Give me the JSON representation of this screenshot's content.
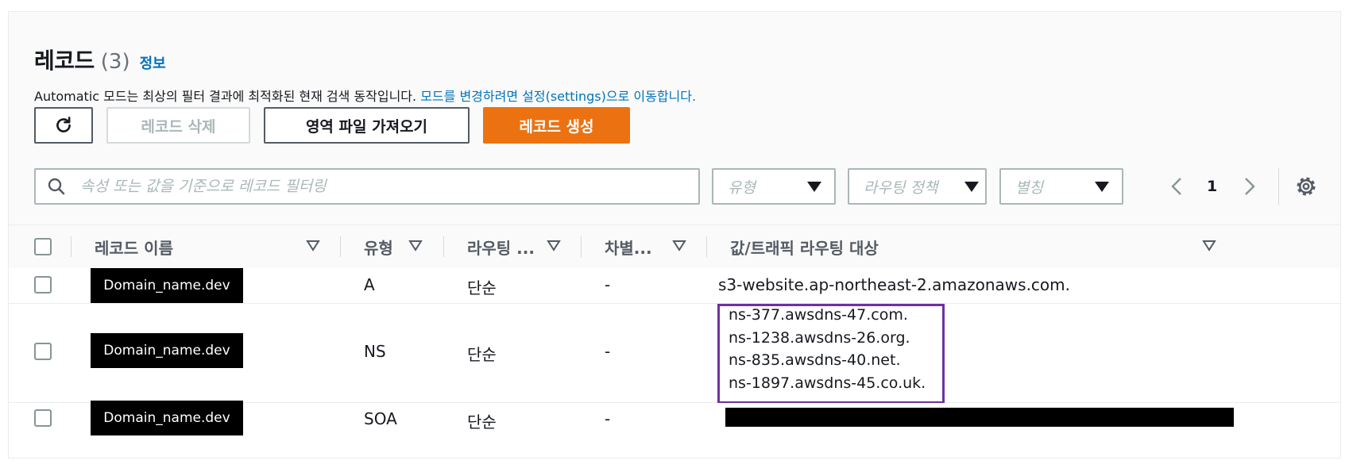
{
  "header": {
    "title": "레코드",
    "count": "(3)",
    "info_link": "정보",
    "description_prefix": "Automatic 모드는 최상의 필터 결과에 최적화된 현재 검색 동작입니다.",
    "description_link": "모드를 변경하려면 설정(settings)으로 이동합니다."
  },
  "actions": {
    "refresh_icon": "refresh-icon",
    "delete_label": "레코드 삭제",
    "import_label": "영역 파일 가져오기",
    "create_label": "레코드 생성",
    "create_color": "#ec7211"
  },
  "filters": {
    "search_placeholder": "속성 또는 값을 기준으로 레코드 필터링",
    "type_placeholder": "유형",
    "routing_placeholder": "라우팅 정책",
    "alias_placeholder": "별칭"
  },
  "pagination": {
    "current_page": "1"
  },
  "table": {
    "columns": [
      "레코드 이름",
      "유형",
      "라우팅 ...",
      "차별...",
      "값/트래픽 라우팅 대상"
    ],
    "rows": [
      {
        "name": "Domain_name.dev",
        "type": "A",
        "routing": "단순",
        "diff": "-",
        "values": [
          "s3-website.ap-northeast-2.amazonaws.com."
        ]
      },
      {
        "name": "Domain_name.dev",
        "type": "NS",
        "routing": "단순",
        "diff": "-",
        "values": [
          "ns-377.awsdns-47.com.",
          "ns-1238.awsdns-26.org.",
          "ns-835.awsdns-40.net.",
          "ns-1897.awsdns-45.co.uk."
        ]
      },
      {
        "name": "Domain_name.dev",
        "type": "SOA",
        "routing": "단순",
        "diff": "-",
        "values": []
      }
    ],
    "highlight_color": "#7030a0"
  }
}
